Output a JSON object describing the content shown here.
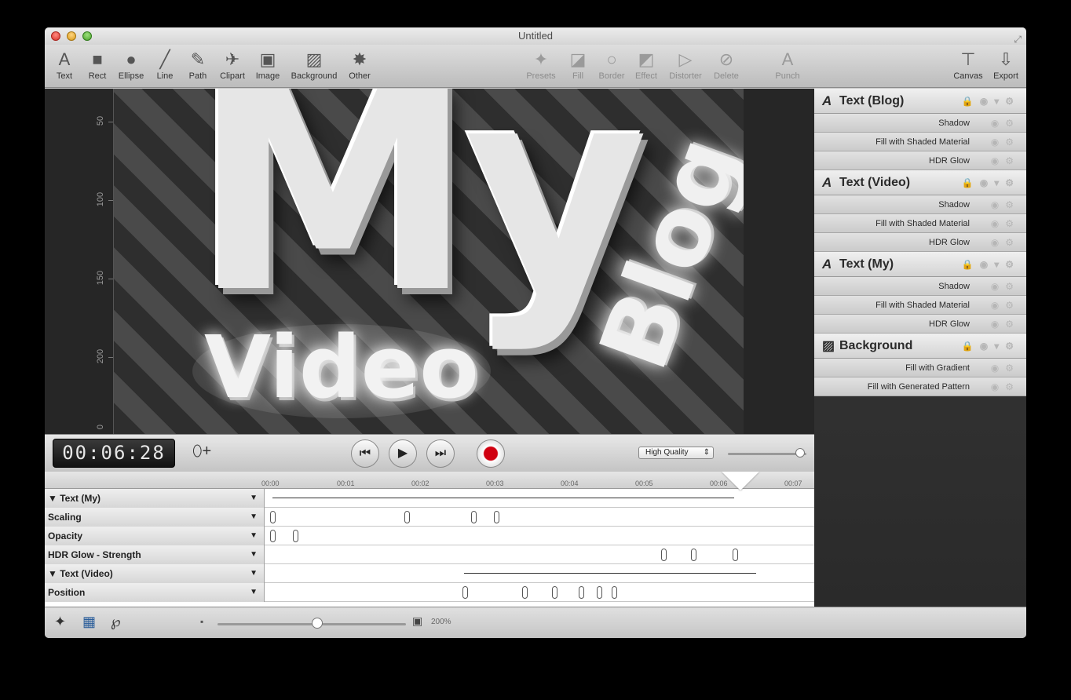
{
  "window": {
    "title": "Untitled"
  },
  "toolbar": {
    "left_tools": [
      {
        "label": "Text",
        "icon": "text-tool-icon"
      },
      {
        "label": "Rect",
        "icon": "rect-tool-icon"
      },
      {
        "label": "Ellipse",
        "icon": "ellipse-tool-icon"
      },
      {
        "label": "Line",
        "icon": "line-tool-icon"
      },
      {
        "label": "Path",
        "icon": "path-tool-icon"
      },
      {
        "label": "Clipart",
        "icon": "clipart-tool-icon"
      },
      {
        "label": "Image",
        "icon": "image-tool-icon"
      },
      {
        "label": "Background",
        "icon": "background-tool-icon"
      },
      {
        "label": "Other",
        "icon": "other-tool-icon"
      }
    ],
    "mid_tools": [
      {
        "label": "Presets",
        "icon": "presets-icon"
      },
      {
        "label": "Fill",
        "icon": "fill-icon"
      },
      {
        "label": "Border",
        "icon": "border-icon"
      },
      {
        "label": "Effect",
        "icon": "effect-icon"
      },
      {
        "label": "Distorter",
        "icon": "distorter-icon"
      },
      {
        "label": "Delete",
        "icon": "delete-icon"
      },
      {
        "label": "Punch",
        "icon": "punch-icon"
      }
    ],
    "right_tools": [
      {
        "label": "Canvas",
        "icon": "canvas-icon"
      },
      {
        "label": "Export",
        "icon": "export-icon"
      }
    ]
  },
  "ruler": {
    "labels": [
      "50",
      "100",
      "150",
      "200",
      "0"
    ]
  },
  "artwork": {
    "line1": "My",
    "line2": "Video",
    "line3": "Blog"
  },
  "layers": [
    {
      "title": "Text (Blog)",
      "icon": "text-layer-icon",
      "effects": [
        "Shadow",
        "Fill with Shaded Material",
        "HDR Glow"
      ]
    },
    {
      "title": "Text (Video)",
      "icon": "text-layer-icon",
      "effects": [
        "Shadow",
        "Fill with Shaded Material",
        "HDR Glow"
      ]
    },
    {
      "title": "Text (My)",
      "icon": "text-layer-icon",
      "effects": [
        "Shadow",
        "Fill with Shaded Material",
        "HDR Glow"
      ]
    },
    {
      "title": "Background",
      "icon": "background-layer-icon",
      "effects": [
        "Fill with Gradient",
        "Fill with Generated Pattern"
      ]
    }
  ],
  "transport": {
    "timecode": "00:06:28",
    "quality": "High Quality",
    "quality_level": 0.9
  },
  "timeline": {
    "ticks": [
      "00:00",
      "00:01",
      "00:02",
      "00:03",
      "00:04",
      "00:05",
      "00:06",
      "00:07"
    ],
    "rows": [
      {
        "name": "Text (My)",
        "group": true
      },
      {
        "name": "Scaling",
        "group": false
      },
      {
        "name": "Opacity",
        "group": false
      },
      {
        "name": "HDR Glow - Strength",
        "group": false
      },
      {
        "name": "Text (Video)",
        "group": true
      },
      {
        "name": "Position",
        "group": false
      }
    ]
  },
  "bottom": {
    "zoom": "200%",
    "zoom_level": 0.5
  }
}
